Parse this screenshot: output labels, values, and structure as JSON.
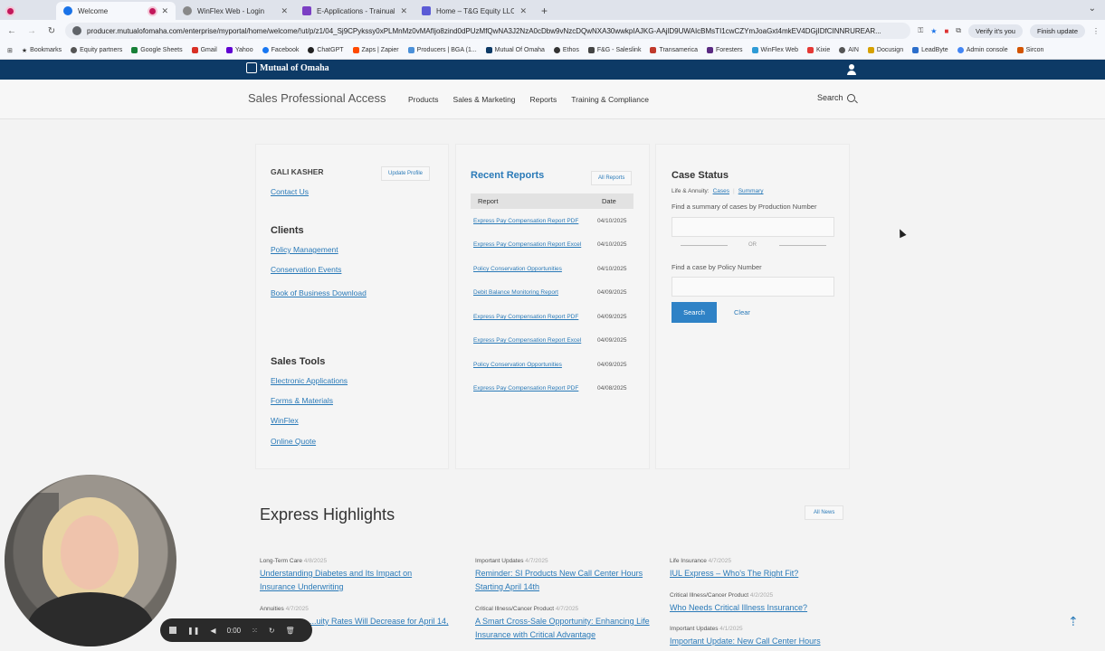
{
  "browser": {
    "tabs": [
      {
        "label": ""
      },
      {
        "label": "Welcome"
      },
      {
        "label": "WinFlex Web - Login"
      },
      {
        "label": "E-Applications - Trainual"
      },
      {
        "label": "Home – T&G Equity LLC – Si"
      }
    ],
    "url": "producer.mutualofomaha.com/enterprise/myportal/home/welcome/!ut/p/z1/04_Sj9CPykssy0xPLMnMz0vMAfIjo8zind0dPUzMfQwNA3J2NzA0cDbw9vNzcDQwNXA30wwkpIAJKG-AAjlD9UWAIcBMsTI1cwCZYmJoaGxt4mkEV4DGjIDfCINNRUREAR...",
    "verify_label": "Verify it's you",
    "finish_update_label": "Finish update",
    "bookmarks": [
      "Bookmarks",
      "Equity partners",
      "Google Sheets",
      "Gmail",
      "Yahoo",
      "Facebook",
      "ChatGPT",
      "Zaps | Zapier",
      "Producers | BGA (1...",
      "Mutual Of Omaha",
      "Ethos",
      "F&G - Saleslink",
      "Transamerica",
      "Foresters",
      "WinFlex Web",
      "Kixie",
      "AIN",
      "Docusign",
      "LeadByte",
      "Admin console",
      "Sircon"
    ]
  },
  "site": {
    "logo": "Mutual of Omaha",
    "brand": "Sales Professional Access",
    "nav": [
      "Products",
      "Sales & Marketing",
      "Reports",
      "Training & Compliance"
    ],
    "search_label": "Search"
  },
  "profile": {
    "name": "GALI KASHER",
    "update_label": "Update Profile",
    "contact_label": "Contact Us",
    "clients_title": "Clients",
    "clients_links": [
      "Policy Management",
      "Conservation Events",
      "Book of Business Download"
    ],
    "tools_title": "Sales Tools",
    "tools_links": [
      "Electronic Applications",
      "Forms & Materials",
      "WinFlex",
      "Online Quote"
    ]
  },
  "reports": {
    "title": "Recent Reports",
    "all_label": "All Reports",
    "col_report": "Report",
    "col_date": "Date",
    "rows": [
      {
        "name": "Express Pay Compensation Report PDF",
        "date": "04/10/2025"
      },
      {
        "name": "Express Pay Compensation Report Excel",
        "date": "04/10/2025"
      },
      {
        "name": "Policy Conservation Opportunities",
        "date": "04/10/2025"
      },
      {
        "name": "Debit Balance Monitoring Report",
        "date": "04/09/2025"
      },
      {
        "name": "Express Pay Compensation Report PDF",
        "date": "04/09/2025"
      },
      {
        "name": "Express Pay Compensation Report Excel",
        "date": "04/09/2025"
      },
      {
        "name": "Policy Conservation Opportunities",
        "date": "04/09/2025"
      },
      {
        "name": "Express Pay Compensation Report PDF",
        "date": "04/08/2025"
      }
    ]
  },
  "case_status": {
    "title": "Case Status",
    "sub_prefix": "Life & Annuity:",
    "cases_link": "Cases",
    "summary_link": "Summary",
    "prod_hint": "Find a summary of cases by Production Number",
    "or": "OR",
    "policy_hint": "Find a case by Policy Number",
    "search_btn": "Search",
    "clear_btn": "Clear"
  },
  "highlights": {
    "title": "Express Highlights",
    "all_label": "All News",
    "items": [
      {
        "cat": "Long-Term Care",
        "date": "4/8/2025",
        "title": "Understanding Diabetes and Its Impact on Insurance Underwriting"
      },
      {
        "cat": "Important Updates",
        "date": "4/7/2025",
        "title": "Reminder: SI Products New Call Center Hours Starting April 14th"
      },
      {
        "cat": "Life Insurance",
        "date": "4/7/2025",
        "title": "IUL Express – Who's The Right Fit?"
      },
      {
        "cat": "Annuities",
        "date": "4/7/2025",
        "title": "...uity Rates Will Decrease for April 14,"
      },
      {
        "cat": "Critical Illness/Cancer Product",
        "date": "4/7/2025",
        "title": "A Smart Cross-Sale Opportunity: Enhancing Life Insurance with Critical Advantage"
      },
      {
        "cat": "Critical Illness/Cancer Product",
        "date": "4/2/2025",
        "title": "Who Needs Critical Illness Insurance?"
      },
      {
        "cat": "Important Updates",
        "date": "4/1/2025",
        "title": "Important Update: New Call Center Hours"
      }
    ]
  },
  "recorder": {
    "time": "0:00"
  }
}
